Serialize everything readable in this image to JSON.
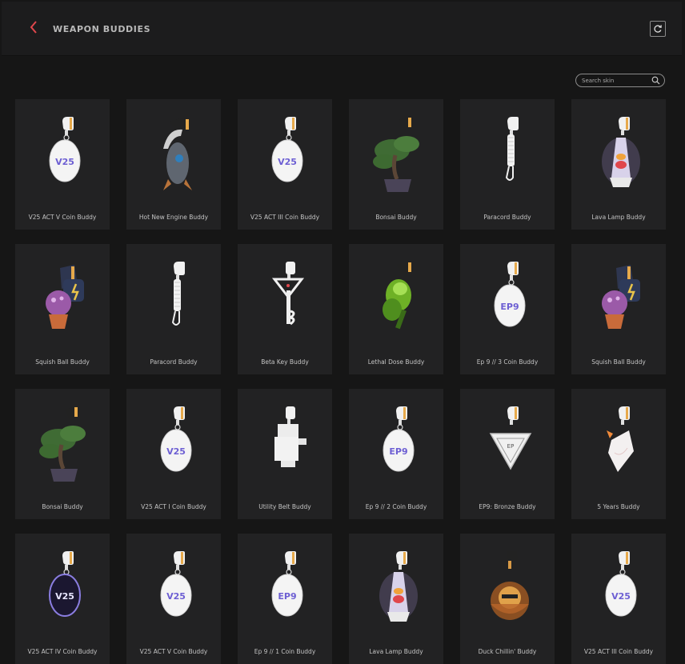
{
  "header": {
    "title": "WEAPON BUDDIES",
    "back_icon": "chevron-left-icon",
    "refresh_icon": "refresh-icon"
  },
  "search": {
    "placeholder": "Search skin",
    "value": "",
    "icon": "search-icon"
  },
  "colors": {
    "accent": "#e0474c",
    "background": "#161616",
    "card": "#222223"
  },
  "buddies": [
    {
      "name": "V25 ACT V Coin Buddy",
      "art": "coin",
      "text": "V25"
    },
    {
      "name": "Hot New Engine Buddy",
      "art": "rocket",
      "text": ""
    },
    {
      "name": "V25 ACT III Coin Buddy",
      "art": "coin",
      "text": "V25"
    },
    {
      "name": "Bonsai Buddy",
      "art": "bonsai",
      "text": ""
    },
    {
      "name": "Paracord Buddy",
      "art": "paracord",
      "text": ""
    },
    {
      "name": "Lava Lamp Buddy",
      "art": "lava",
      "text": ""
    },
    {
      "name": "Squish Ball Buddy",
      "art": "squish",
      "text": ""
    },
    {
      "name": "Paracord Buddy",
      "art": "paracord",
      "text": ""
    },
    {
      "name": "Beta Key Buddy",
      "art": "key",
      "text": ""
    },
    {
      "name": "Lethal Dose Buddy",
      "art": "lethal",
      "text": ""
    },
    {
      "name": "Ep 9 // 3 Coin Buddy",
      "art": "coin",
      "text": "EP9"
    },
    {
      "name": "Squish Ball Buddy",
      "art": "squish",
      "text": ""
    },
    {
      "name": "Bonsai Buddy",
      "art": "bonsai",
      "text": ""
    },
    {
      "name": "V25 ACT I Coin Buddy",
      "art": "coin",
      "text": "V25"
    },
    {
      "name": "Utility Belt Buddy",
      "art": "utility",
      "text": ""
    },
    {
      "name": "Ep 9 // 2 Coin Buddy",
      "art": "coin",
      "text": "EP9"
    },
    {
      "name": "EP9: Bronze Buddy",
      "art": "triangle",
      "text": "EP"
    },
    {
      "name": "5 Years Buddy",
      "art": "fiveyears",
      "text": ""
    },
    {
      "name": "V25 ACT IV Coin Buddy",
      "art": "coindark",
      "text": "V25"
    },
    {
      "name": "V25 ACT V Coin Buddy",
      "art": "coin",
      "text": "V25"
    },
    {
      "name": "Ep 9 // 1 Coin Buddy",
      "art": "coin",
      "text": "EP9"
    },
    {
      "name": "Lava Lamp Buddy",
      "art": "lava",
      "text": ""
    },
    {
      "name": "Duck Chillin' Buddy",
      "art": "duck",
      "text": ""
    },
    {
      "name": "V25 ACT III Coin Buddy",
      "art": "coin",
      "text": "V25"
    }
  ]
}
